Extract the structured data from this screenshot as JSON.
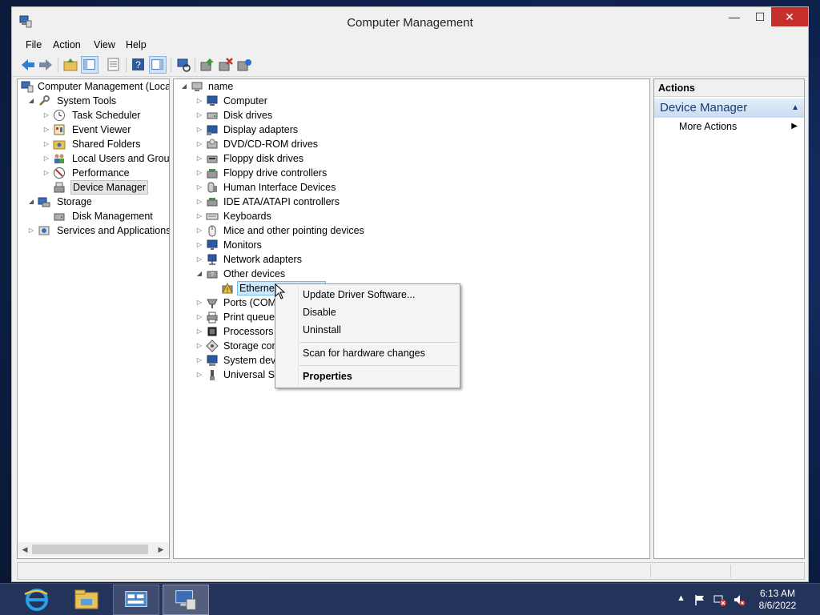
{
  "window": {
    "title": "Computer Management",
    "min": "—",
    "max": "☐",
    "close": "✕"
  },
  "menu": [
    "File",
    "Action",
    "View",
    "Help"
  ],
  "left_tree": [
    {
      "label": "Computer Management (Local",
      "level": 0,
      "expander": "",
      "icon": "computer-management-icon"
    },
    {
      "label": "System Tools",
      "level": 1,
      "expander": "◢",
      "icon": "system-tools-icon"
    },
    {
      "label": "Task Scheduler",
      "level": 2,
      "expander": "▷",
      "icon": "clock-icon"
    },
    {
      "label": "Event Viewer",
      "level": 2,
      "expander": "▷",
      "icon": "event-viewer-icon"
    },
    {
      "label": "Shared Folders",
      "level": 2,
      "expander": "▷",
      "icon": "shared-folders-icon"
    },
    {
      "label": "Local Users and Groups",
      "level": 2,
      "expander": "▷",
      "icon": "users-icon"
    },
    {
      "label": "Performance",
      "level": 2,
      "expander": "▷",
      "icon": "performance-icon"
    },
    {
      "label": "Device Manager",
      "level": 2,
      "expander": "",
      "icon": "device-manager-icon",
      "selected": true
    },
    {
      "label": "Storage",
      "level": 1,
      "expander": "◢",
      "icon": "storage-icon"
    },
    {
      "label": "Disk Management",
      "level": 2,
      "expander": "",
      "icon": "disk-management-icon"
    },
    {
      "label": "Services and Applications",
      "level": 1,
      "expander": "▷",
      "icon": "services-icon"
    }
  ],
  "device_tree": {
    "root": {
      "label": "name",
      "expander": "◢"
    },
    "items": [
      {
        "label": "Computer",
        "expander": "▷",
        "icon": "computer-icon"
      },
      {
        "label": "Disk drives",
        "expander": "▷",
        "icon": "disk-drive-icon"
      },
      {
        "label": "Display adapters",
        "expander": "▷",
        "icon": "display-adapter-icon"
      },
      {
        "label": "DVD/CD-ROM drives",
        "expander": "▷",
        "icon": "dvd-icon"
      },
      {
        "label": "Floppy disk drives",
        "expander": "▷",
        "icon": "floppy-icon"
      },
      {
        "label": "Floppy drive controllers",
        "expander": "▷",
        "icon": "floppy-controller-icon"
      },
      {
        "label": "Human Interface Devices",
        "expander": "▷",
        "icon": "hid-icon"
      },
      {
        "label": "IDE ATA/ATAPI controllers",
        "expander": "▷",
        "icon": "ide-icon"
      },
      {
        "label": "Keyboards",
        "expander": "▷",
        "icon": "keyboard-icon"
      },
      {
        "label": "Mice and other pointing devices",
        "expander": "▷",
        "icon": "mouse-icon"
      },
      {
        "label": "Monitors",
        "expander": "▷",
        "icon": "monitor-icon"
      },
      {
        "label": "Network adapters",
        "expander": "▷",
        "icon": "network-adapter-icon"
      },
      {
        "label": "Other devices",
        "expander": "◢",
        "icon": "other-devices-icon"
      },
      {
        "label": "Ethernet",
        "expander": "",
        "icon": "warning-device-icon",
        "child": true
      },
      {
        "label": "Ports (COM",
        "expander": "▷",
        "icon": "port-icon"
      },
      {
        "label": "Print queues",
        "expander": "▷",
        "icon": "printer-icon"
      },
      {
        "label": "Processors",
        "expander": "▷",
        "icon": "processor-icon"
      },
      {
        "label": "Storage cont",
        "expander": "▷",
        "icon": "storage-controller-icon"
      },
      {
        "label": "System devic",
        "expander": "▷",
        "icon": "system-device-icon"
      },
      {
        "label": "Universal Se",
        "expander": "▷",
        "icon": "usb-icon"
      }
    ]
  },
  "actions": {
    "header": "Actions",
    "group": "Device Manager",
    "item": "More Actions"
  },
  "context_menu": {
    "update": "Update Driver Software...",
    "disable": "Disable",
    "uninstall": "Uninstall",
    "scan": "Scan for hardware changes",
    "properties": "Properties"
  },
  "taskbar": {
    "time": "6:13 AM",
    "date": "8/6/2022"
  },
  "colors": {
    "accent": "#0078d7",
    "close": "#c7302a",
    "taskbar": "#24335a"
  }
}
